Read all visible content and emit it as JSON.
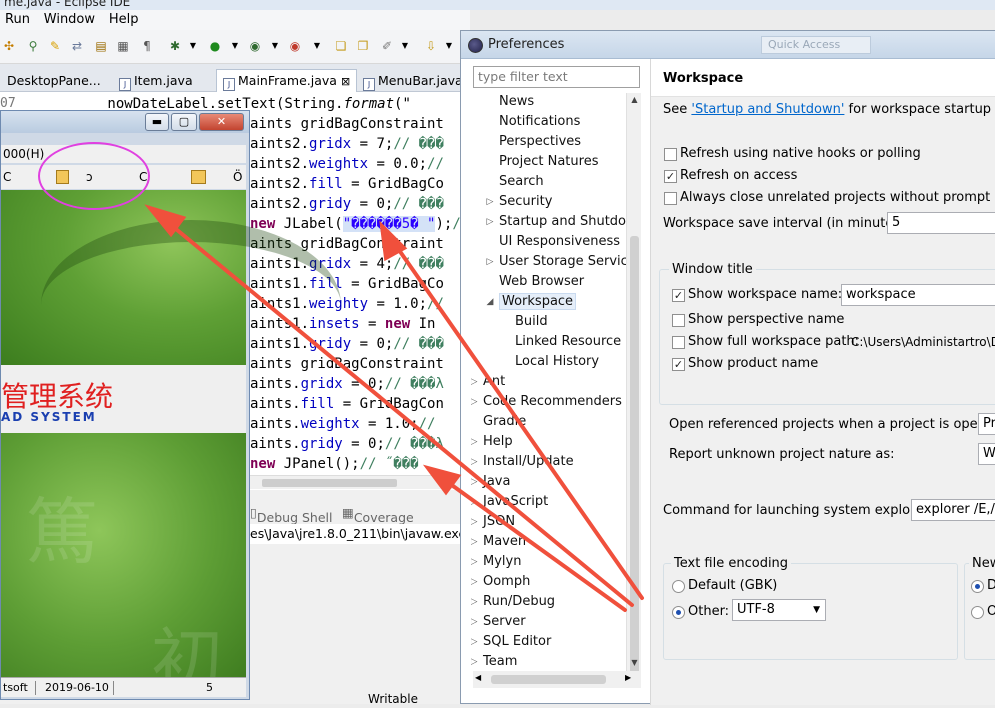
{
  "eclipse": {
    "window_title": "me.java - Eclipse IDE",
    "menu": [
      "Run",
      "Window",
      "Help"
    ],
    "tabs": [
      {
        "label": "DesktopPane..."
      },
      {
        "label": "Item.java"
      },
      {
        "label": "MainFrame.java",
        "close": "⊠",
        "active": true
      },
      {
        "label": "MenuBar.java"
      }
    ],
    "line_number": "07",
    "code_lines": [
      {
        "parts": [
          {
            "t": "        nowDateLabel.setText(String.",
            "c": "p"
          },
          {
            "t": "format",
            "c": "i"
          },
          {
            "t": "(\"",
            "c": "p"
          }
        ]
      },
      {
        "parts": [
          {
            "t": "aints gridBagConstraint",
            "c": "p"
          }
        ]
      },
      {
        "parts": [
          {
            "t": "aints2.",
            "c": "p"
          },
          {
            "t": "gridx",
            "c": "fd"
          },
          {
            "t": " = 7;",
            "c": "p"
          },
          {
            "t": "// ���",
            "c": "cm"
          }
        ]
      },
      {
        "parts": [
          {
            "t": "aints2.",
            "c": "p"
          },
          {
            "t": "weightx",
            "c": "fd"
          },
          {
            "t": " = 0.0;",
            "c": "p"
          },
          {
            "t": "//",
            "c": "cm"
          }
        ]
      },
      {
        "parts": [
          {
            "t": "aints2.",
            "c": "p"
          },
          {
            "t": "fill",
            "c": "fd"
          },
          {
            "t": " = GridBagCo",
            "c": "p"
          }
        ]
      },
      {
        "parts": [
          {
            "t": "aints2.",
            "c": "p"
          },
          {
            "t": "gridy",
            "c": "fd"
          },
          {
            "t": " = 0;",
            "c": "p"
          },
          {
            "t": "// ���",
            "c": "cm"
          }
        ]
      },
      {
        "parts": [
          {
            "t": "new",
            "c": "kw"
          },
          {
            "t": " JLabel(",
            "c": "p"
          },
          {
            "t": "\"������5� \"",
            "c": "str",
            "hl": true
          },
          {
            "t": ");",
            "c": "p"
          },
          {
            "t": "//",
            "c": "cm"
          }
        ]
      },
      {
        "parts": [
          {
            "t": "aints gridBagConstraint",
            "c": "p"
          }
        ]
      },
      {
        "parts": [
          {
            "t": "aints1.",
            "c": "p"
          },
          {
            "t": "gridx",
            "c": "fd"
          },
          {
            "t": " = 4;",
            "c": "p"
          },
          {
            "t": "// ���",
            "c": "cm"
          }
        ]
      },
      {
        "parts": [
          {
            "t": "aints1.",
            "c": "p"
          },
          {
            "t": "fill",
            "c": "fd"
          },
          {
            "t": " = GridBagCo",
            "c": "p"
          }
        ]
      },
      {
        "parts": [
          {
            "t": "aints1.",
            "c": "p"
          },
          {
            "t": "weighty",
            "c": "fd"
          },
          {
            "t": " = 1.0;",
            "c": "p"
          },
          {
            "t": "//",
            "c": "cm"
          }
        ]
      },
      {
        "parts": [
          {
            "t": "aints1.",
            "c": "p"
          },
          {
            "t": "insets",
            "c": "fd"
          },
          {
            "t": " = ",
            "c": "p"
          },
          {
            "t": "new",
            "c": "kw"
          },
          {
            "t": " In",
            "c": "p"
          }
        ]
      },
      {
        "parts": [
          {
            "t": "aints1.",
            "c": "p"
          },
          {
            "t": "gridy",
            "c": "fd"
          },
          {
            "t": " = 0;",
            "c": "p"
          },
          {
            "t": "// ���",
            "c": "cm"
          }
        ]
      },
      {
        "parts": [
          {
            "t": "aints gridBagConstraint",
            "c": "p"
          }
        ]
      },
      {
        "parts": [
          {
            "t": "aints.",
            "c": "p"
          },
          {
            "t": "gridx",
            "c": "fd"
          },
          {
            "t": " = 0;",
            "c": "p"
          },
          {
            "t": "// ���λ",
            "c": "cm"
          }
        ]
      },
      {
        "parts": [
          {
            "t": "aints.",
            "c": "p"
          },
          {
            "t": "fill",
            "c": "fd"
          },
          {
            "t": " = GridBagCon",
            "c": "p"
          }
        ]
      },
      {
        "parts": [
          {
            "t": "aints.",
            "c": "p"
          },
          {
            "t": "weightx",
            "c": "fd"
          },
          {
            "t": " = 1.0;",
            "c": "p"
          },
          {
            "t": "//",
            "c": "cm"
          }
        ]
      },
      {
        "parts": [
          {
            "t": "aints.",
            "c": "p"
          },
          {
            "t": "gridy",
            "c": "fd"
          },
          {
            "t": " = 0;",
            "c": "p"
          },
          {
            "t": "// ���λ",
            "c": "cm"
          }
        ]
      },
      {
        "parts": [
          {
            "t": "new",
            "c": "kw"
          },
          {
            "t": " JPanel();",
            "c": "p"
          },
          {
            "t": "// ˝���",
            "c": "cm"
          }
        ]
      }
    ],
    "bottom_tabs": [
      "Debug Shell",
      "Coverage"
    ],
    "console_text": "es\\Java\\jre1.8.0_211\\bin\\javaw.exe",
    "status_writable": "Writable"
  },
  "app": {
    "menu_label": "000(H)",
    "toolbar_left": "C",
    "toolbar_mid": "ɔ",
    "toolbar_c": "C",
    "toolbar_right": "Ö",
    "title_cn": "管理系统",
    "title_en": "AD SYSTEM",
    "status_company": "tsoft",
    "status_date": "2019-06-10",
    "status_num": "5",
    "buttons": {
      "minimize": "▬",
      "maximize": "▢",
      "close": "✕"
    }
  },
  "prefs": {
    "title": "Preferences",
    "quick_access": "Quick Access",
    "filter_placeholder": "type filter text",
    "tree": [
      {
        "label": "News",
        "level": 1,
        "twisty": ""
      },
      {
        "label": "Notifications",
        "level": 1,
        "twisty": ""
      },
      {
        "label": "Perspectives",
        "level": 1,
        "twisty": ""
      },
      {
        "label": "Project Natures",
        "level": 1,
        "twisty": ""
      },
      {
        "label": "Search",
        "level": 1,
        "twisty": ""
      },
      {
        "label": "Security",
        "level": 1,
        "twisty": "▷"
      },
      {
        "label": "Startup and Shutdo",
        "level": 1,
        "twisty": "▷"
      },
      {
        "label": "UI Responsiveness",
        "level": 1,
        "twisty": ""
      },
      {
        "label": "User Storage Servic",
        "level": 1,
        "twisty": "▷"
      },
      {
        "label": "Web Browser",
        "level": 1,
        "twisty": ""
      },
      {
        "label": "Workspace",
        "level": 1,
        "twisty": "◢",
        "selected": true
      },
      {
        "label": "Build",
        "level": 2,
        "twisty": ""
      },
      {
        "label": "Linked Resource",
        "level": 2,
        "twisty": ""
      },
      {
        "label": "Local History",
        "level": 2,
        "twisty": ""
      },
      {
        "label": "Ant",
        "level": 0,
        "twisty": "▷"
      },
      {
        "label": "Code Recommenders",
        "level": 0,
        "twisty": "▷"
      },
      {
        "label": "Gradle",
        "level": 0,
        "twisty": ""
      },
      {
        "label": "Help",
        "level": 0,
        "twisty": "▷"
      },
      {
        "label": "Install/Update",
        "level": 0,
        "twisty": "▷"
      },
      {
        "label": "Java",
        "level": 0,
        "twisty": "▷"
      },
      {
        "label": "JavaScript",
        "level": 0,
        "twisty": "▷"
      },
      {
        "label": "JSON",
        "level": 0,
        "twisty": "▷"
      },
      {
        "label": "Maven",
        "level": 0,
        "twisty": "▷"
      },
      {
        "label": "Mylyn",
        "level": 0,
        "twisty": "▷"
      },
      {
        "label": "Oomph",
        "level": 0,
        "twisty": "▷"
      },
      {
        "label": "Run/Debug",
        "level": 0,
        "twisty": "▷"
      },
      {
        "label": "Server",
        "level": 0,
        "twisty": "▷"
      },
      {
        "label": "SQL Editor",
        "level": 0,
        "twisty": "▷"
      },
      {
        "label": "Team",
        "level": 0,
        "twisty": "▷"
      }
    ],
    "page": {
      "heading": "Workspace",
      "see_prefix": "See ",
      "see_link": "'Startup and Shutdown'",
      "see_suffix": " for workspace startup and sh",
      "checks": [
        {
          "label": "Refresh using native hooks or polling",
          "checked": false
        },
        {
          "label": "Refresh on access",
          "checked": true
        },
        {
          "label": "Always close unrelated projects without prompt",
          "checked": false
        }
      ],
      "save_interval_label": "Workspace save interval (in minutes):",
      "save_interval_value": "5",
      "window_title_group": "Window title",
      "show_workspace_name_label": "Show workspace name:",
      "show_workspace_name_checked": true,
      "workspace_name_value": "workspace",
      "show_perspective_name_label": "Show perspective name",
      "show_perspective_name_checked": false,
      "show_full_path_label": "Show full workspace path:",
      "show_full_path_checked": false,
      "full_path_value": "C:\\Users\\Administartro\\D",
      "show_product_name_label": "Show product name",
      "show_product_name_checked": true,
      "open_referenced_label": "Open referenced projects when a project is opened:",
      "open_referenced_value": "Pr",
      "report_unknown_label": "Report unknown project nature as:",
      "report_unknown_value": "W",
      "command_label": "Command for launching system explorer:",
      "command_value": "explorer /E,/s",
      "encoding_group": "Text file encoding",
      "default_gbk_label": "Default (GBK)",
      "other_label": "Other:",
      "other_value": "UTF-8",
      "new_group": "New",
      "new_opt1": "D",
      "new_opt2": "O"
    }
  },
  "colors": {
    "annotation_arrow": "#f0503c",
    "annotation_ellipse": "#e040e0"
  }
}
